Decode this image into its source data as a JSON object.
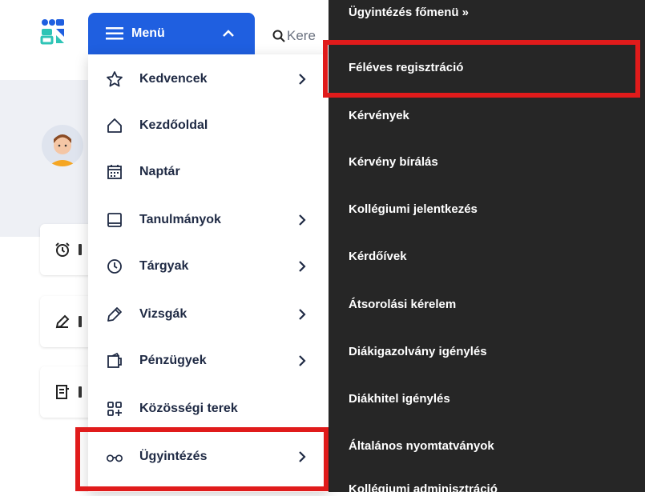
{
  "search": {
    "placeholder": "Kere"
  },
  "menu_button": {
    "label": "Menü"
  },
  "menu": {
    "items": [
      {
        "label": "Kedvencek",
        "icon": "star-icon",
        "has_submenu": true
      },
      {
        "label": "Kezdőoldal",
        "icon": "home-icon",
        "has_submenu": false
      },
      {
        "label": "Naptár",
        "icon": "calendar-icon",
        "has_submenu": false
      },
      {
        "label": "Tanulmányok",
        "icon": "book-icon",
        "has_submenu": true
      },
      {
        "label": "Tárgyak",
        "icon": "clock-icon",
        "has_submenu": true
      },
      {
        "label": "Vizsgák",
        "icon": "pencil-icon",
        "has_submenu": true
      },
      {
        "label": "Pénzügyek",
        "icon": "wallet-icon",
        "has_submenu": true
      },
      {
        "label": "Közösségi terek",
        "icon": "grid-plus-icon",
        "has_submenu": false
      },
      {
        "label": "Ügyintézés",
        "icon": "glasses-icon",
        "has_submenu": true
      }
    ]
  },
  "submenu": {
    "items": [
      "Ügyintézés főmenü »",
      "Féléves regisztráció",
      "Kérvények",
      "Kérvény bírálás",
      "Kollégiumi jelentkezés",
      "Kérdőívek",
      "Átsorolási kérelem",
      "Diákigazolvány igénylés",
      "Diákhitel igénylés",
      "Általános nyomtatványok",
      "Kollégiumi adminisztráció"
    ]
  },
  "colors": {
    "accent": "#1f5fe0",
    "highlight": "#e01b1b",
    "submenu_bg": "#262626"
  }
}
